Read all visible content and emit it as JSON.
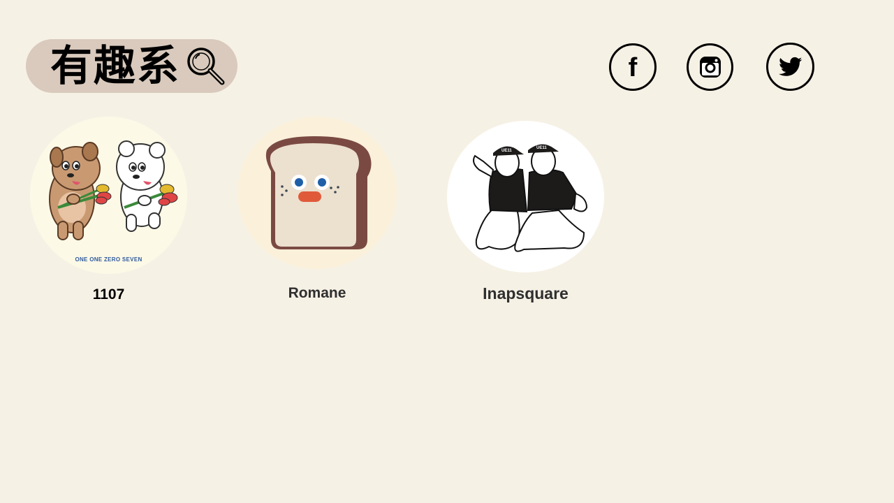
{
  "header": {
    "title": "有趣系",
    "search_icon": "magnifier-icon",
    "pill_color": "#d9cabd"
  },
  "social": [
    {
      "name": "facebook",
      "icon": "facebook-icon",
      "glyph": "f"
    },
    {
      "name": "instagram",
      "icon": "instagram-icon"
    },
    {
      "name": "twitter",
      "icon": "twitter-bird-icon"
    }
  ],
  "characters": [
    {
      "label": "1107",
      "image_caption": "ONE ONE ZERO SEVEN",
      "bg": "#fdf9e7"
    },
    {
      "label": "Romane",
      "bg": "#fbf0da"
    },
    {
      "label": "Inapsquare",
      "cap_text": "UE11",
      "bg": "#ffffff"
    }
  ],
  "colors": {
    "background": "#f6f1e5",
    "text": "#1b1b1b"
  }
}
